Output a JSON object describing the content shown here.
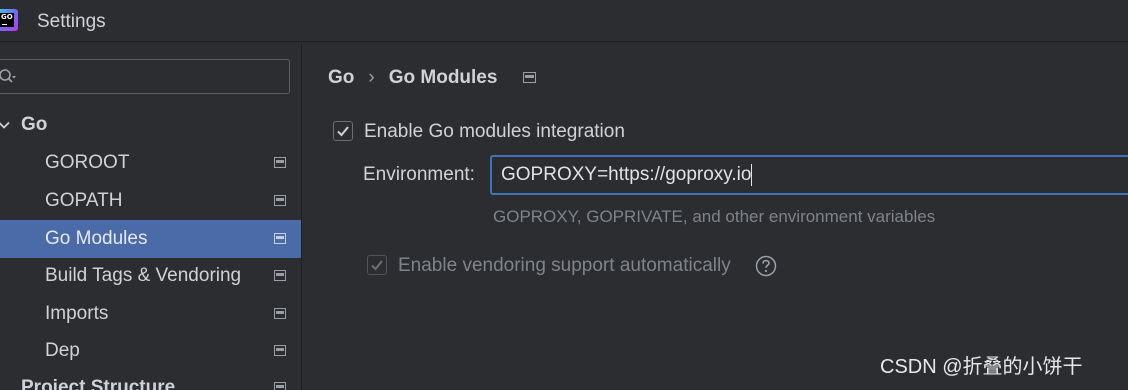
{
  "window": {
    "title": "Settings",
    "app_icon_text": "GO"
  },
  "search": {
    "value": "",
    "placeholder": ""
  },
  "sidebar": {
    "group": "Go",
    "items": [
      {
        "label": "GOROOT"
      },
      {
        "label": "GOPATH"
      },
      {
        "label": "Go Modules",
        "selected": true
      },
      {
        "label": "Build Tags & Vendoring"
      },
      {
        "label": "Imports"
      },
      {
        "label": "Dep"
      }
    ],
    "next_group": "Project Structure"
  },
  "main": {
    "breadcrumb": {
      "parent": "Go",
      "separator": "›",
      "current": "Go Modules"
    },
    "enable_modules": {
      "label": "Enable Go modules integration",
      "checked": true
    },
    "environment": {
      "label": "Environment:",
      "value": "GOPROXY=https://goproxy.io",
      "hint": "GOPROXY, GOPRIVATE, and other environment variables"
    },
    "vendoring": {
      "label": "Enable vendoring support automatically",
      "checked": true,
      "disabled": true
    }
  },
  "watermark": "CSDN @折叠的小饼干",
  "colors": {
    "background": "#2b2d30",
    "selection": "#4a6aa8",
    "input_focus_border": "#3e74b8",
    "text": "#cfd2d6",
    "muted_text": "#7f848a"
  },
  "icons": {
    "search": "search-icon",
    "pin": "settings-pin-icon",
    "help": "help-icon",
    "check": "check-icon",
    "expand": "chevron-down-icon"
  }
}
